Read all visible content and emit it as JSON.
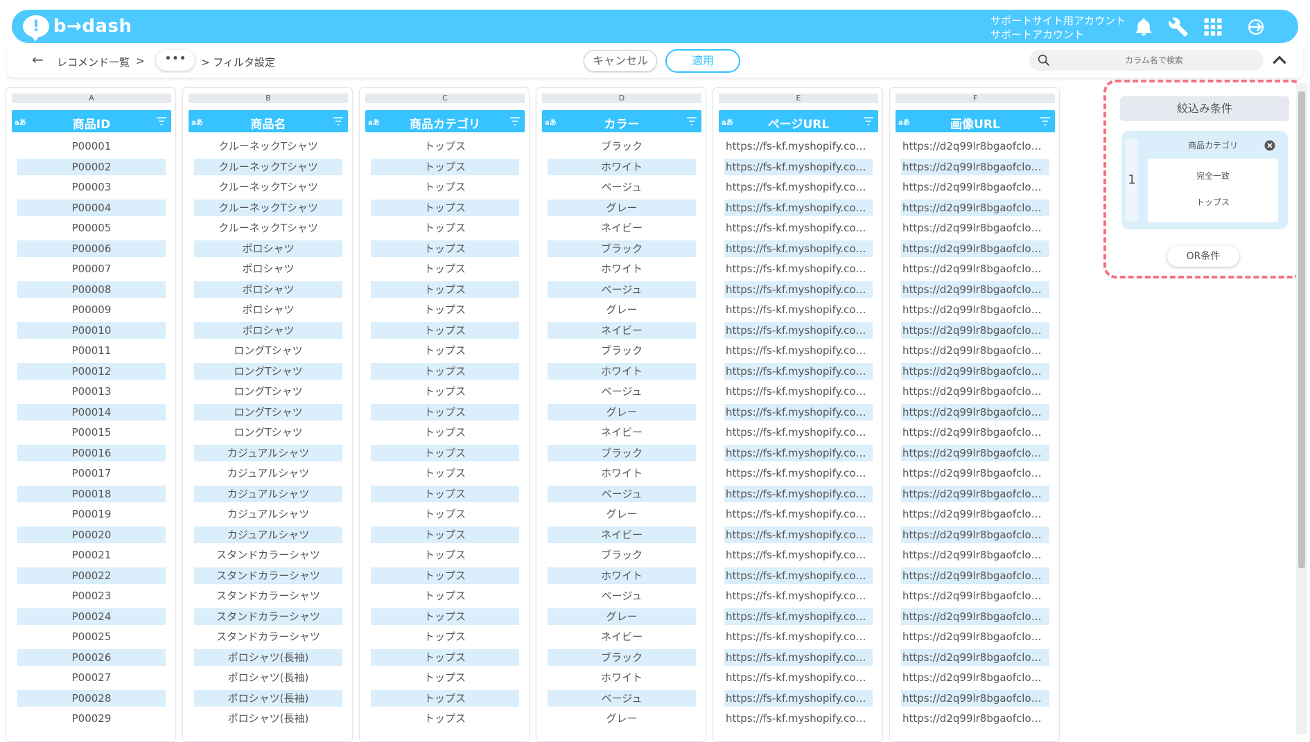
{
  "header": {
    "logo_text": "b→dash",
    "account_line1": "サポートサイト用アカウント",
    "account_line2": "サポートアカウント",
    "icons": [
      "bell-icon",
      "wrench-icon",
      "grid-icon",
      "logout-icon"
    ]
  },
  "toolbar": {
    "breadcrumb_root": "レコメンド一覧",
    "breadcrumb_sep": ">",
    "more_label": "•••",
    "breadcrumb_current": "> フィルタ設定",
    "cancel_label": "キャンセル",
    "apply_label": "適用",
    "search_placeholder": "カラム名で検索"
  },
  "columns": [
    {
      "letter": "A",
      "type": "aあ",
      "title": "商品ID"
    },
    {
      "letter": "B",
      "type": "aあ",
      "title": "商品名"
    },
    {
      "letter": "C",
      "type": "aあ",
      "title": "商品カテゴリ"
    },
    {
      "letter": "D",
      "type": "aあ",
      "title": "カラー"
    },
    {
      "letter": "E",
      "type": "aあ",
      "title": "ページURL"
    },
    {
      "letter": "F",
      "type": "aあ",
      "title": "画像URL"
    }
  ],
  "rows": [
    [
      "P00001",
      "クルーネックTシャツ",
      "トップス",
      "ブラック",
      "https://fs-kf.myshopify.com…",
      "https://d2q99lr8bgaofclo…"
    ],
    [
      "P00002",
      "クルーネックTシャツ",
      "トップス",
      "ホワイト",
      "https://fs-kf.myshopify.com…",
      "https://d2q99lr8bgaofclo…"
    ],
    [
      "P00003",
      "クルーネックTシャツ",
      "トップス",
      "ベージュ",
      "https://fs-kf.myshopify.com…",
      "https://d2q99lr8bgaofclo…"
    ],
    [
      "P00004",
      "クルーネックTシャツ",
      "トップス",
      "グレー",
      "https://fs-kf.myshopify.com…",
      "https://d2q99lr8bgaofclo…"
    ],
    [
      "P00005",
      "クルーネックTシャツ",
      "トップス",
      "ネイビー",
      "https://fs-kf.myshopify.com…",
      "https://d2q99lr8bgaofclo…"
    ],
    [
      "P00006",
      "ポロシャツ",
      "トップス",
      "ブラック",
      "https://fs-kf.myshopify.com…",
      "https://d2q99lr8bgaofclo…"
    ],
    [
      "P00007",
      "ポロシャツ",
      "トップス",
      "ホワイト",
      "https://fs-kf.myshopify.com…",
      "https://d2q99lr8bgaofclo…"
    ],
    [
      "P00008",
      "ポロシャツ",
      "トップス",
      "ベージュ",
      "https://fs-kf.myshopify.com…",
      "https://d2q99lr8bgaofclo…"
    ],
    [
      "P00009",
      "ポロシャツ",
      "トップス",
      "グレー",
      "https://fs-kf.myshopify.com…",
      "https://d2q99lr8bgaofclo…"
    ],
    [
      "P00010",
      "ポロシャツ",
      "トップス",
      "ネイビー",
      "https://fs-kf.myshopify.com…",
      "https://d2q99lr8bgaofclo…"
    ],
    [
      "P00011",
      "ロングTシャツ",
      "トップス",
      "ブラック",
      "https://fs-kf.myshopify.com…",
      "https://d2q99lr8bgaofclo…"
    ],
    [
      "P00012",
      "ロングTシャツ",
      "トップス",
      "ホワイト",
      "https://fs-kf.myshopify.com…",
      "https://d2q99lr8bgaofclo…"
    ],
    [
      "P00013",
      "ロングTシャツ",
      "トップス",
      "ベージュ",
      "https://fs-kf.myshopify.com…",
      "https://d2q99lr8bgaofclo…"
    ],
    [
      "P00014",
      "ロングTシャツ",
      "トップス",
      "グレー",
      "https://fs-kf.myshopify.com…",
      "https://d2q99lr8bgaofclo…"
    ],
    [
      "P00015",
      "ロングTシャツ",
      "トップス",
      "ネイビー",
      "https://fs-kf.myshopify.com…",
      "https://d2q99lr8bgaofclo…"
    ],
    [
      "P00016",
      "カジュアルシャツ",
      "トップス",
      "ブラック",
      "https://fs-kf.myshopify.com…",
      "https://d2q99lr8bgaofclo…"
    ],
    [
      "P00017",
      "カジュアルシャツ",
      "トップス",
      "ホワイト",
      "https://fs-kf.myshopify.com…",
      "https://d2q99lr8bgaofclo…"
    ],
    [
      "P00018",
      "カジュアルシャツ",
      "トップス",
      "ベージュ",
      "https://fs-kf.myshopify.com…",
      "https://d2q99lr8bgaofclo…"
    ],
    [
      "P00019",
      "カジュアルシャツ",
      "トップス",
      "グレー",
      "https://fs-kf.myshopify.com…",
      "https://d2q99lr8bgaofclo…"
    ],
    [
      "P00020",
      "カジュアルシャツ",
      "トップス",
      "ネイビー",
      "https://fs-kf.myshopify.com…",
      "https://d2q99lr8bgaofclo…"
    ],
    [
      "P00021",
      "スタンドカラーシャツ",
      "トップス",
      "ブラック",
      "https://fs-kf.myshopify.com…",
      "https://d2q99lr8bgaofclo…"
    ],
    [
      "P00022",
      "スタンドカラーシャツ",
      "トップス",
      "ホワイト",
      "https://fs-kf.myshopify.com…",
      "https://d2q99lr8bgaofclo…"
    ],
    [
      "P00023",
      "スタンドカラーシャツ",
      "トップス",
      "ベージュ",
      "https://fs-kf.myshopify.com…",
      "https://d2q99lr8bgaofclo…"
    ],
    [
      "P00024",
      "スタンドカラーシャツ",
      "トップス",
      "グレー",
      "https://fs-kf.myshopify.com…",
      "https://d2q99lr8bgaofclo…"
    ],
    [
      "P00025",
      "スタンドカラーシャツ",
      "トップス",
      "ネイビー",
      "https://fs-kf.myshopify.com…",
      "https://d2q99lr8bgaofclo…"
    ],
    [
      "P00026",
      "ポロシャツ(長袖)",
      "トップス",
      "ブラック",
      "https://fs-kf.myshopify.com…",
      "https://d2q99lr8bgaofclo…"
    ],
    [
      "P00027",
      "ポロシャツ(長袖)",
      "トップス",
      "ホワイト",
      "https://fs-kf.myshopify.com…",
      "https://d2q99lr8bgaofclo…"
    ],
    [
      "P00028",
      "ポロシャツ(長袖)",
      "トップス",
      "ベージュ",
      "https://fs-kf.myshopify.com…",
      "https://d2q99lr8bgaofclo…"
    ],
    [
      "P00029",
      "ポロシャツ(長袖)",
      "トップス",
      "グレー",
      "https://fs-kf.myshopify.com…",
      "https://d2q99lr8bgaofclo…"
    ]
  ],
  "filter_panel": {
    "title": "絞込み条件",
    "conditions": [
      {
        "index": "1",
        "column": "商品カテゴリ",
        "match": "完全一致",
        "value": "トップス"
      }
    ],
    "or_label": "OR条件"
  },
  "colors": {
    "accent": "#36c3ff",
    "header_bg": "#4ec9ff",
    "row_alt": "#dbeefb",
    "panel_border": "#f4727f"
  }
}
